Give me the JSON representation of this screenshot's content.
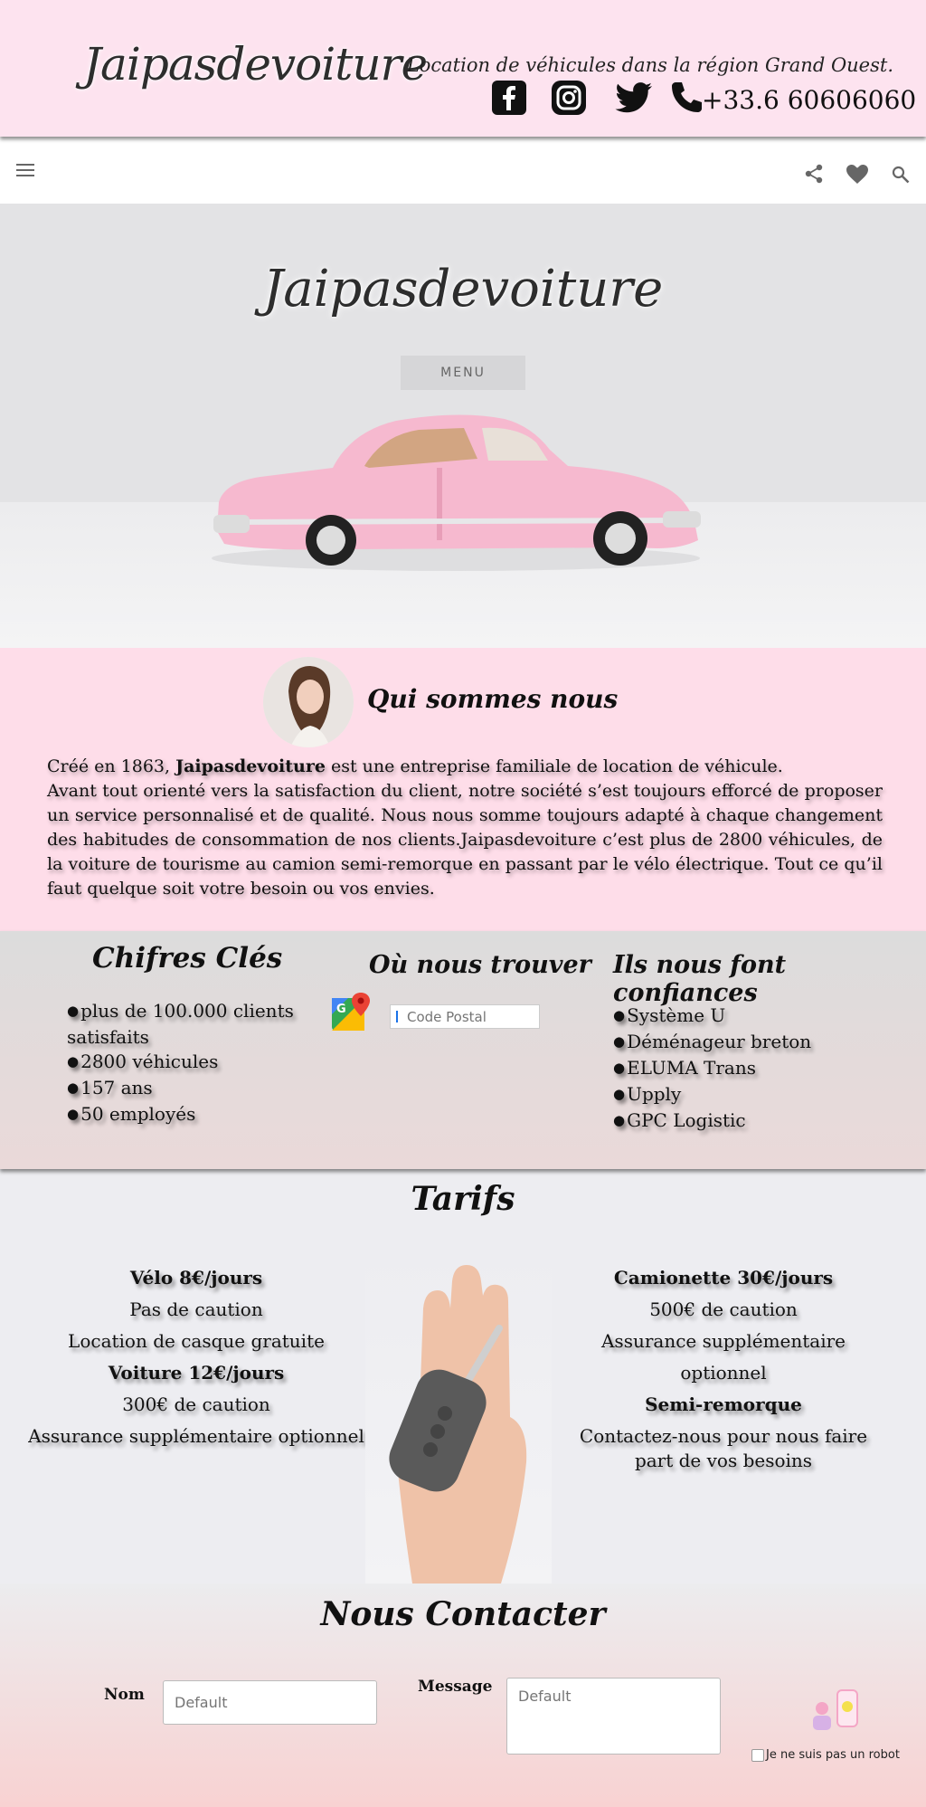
{
  "header": {
    "logo": "Jaipasdevoiture",
    "tagline": "Location de véhicules dans la région Grand Ouest.",
    "phone": "+33.6 60606060",
    "social_icons": [
      "facebook-icon",
      "instagram-icon",
      "twitter-icon",
      "phone-icon"
    ]
  },
  "toolbar": {
    "icons": [
      "menu-icon",
      "share-icon",
      "heart-icon",
      "search-icon"
    ]
  },
  "hero": {
    "title": "Jaipasdevoiture",
    "menu_button": "MENU"
  },
  "about": {
    "title": "Qui sommes nous",
    "intro_prefix": "Créé en 1863, ",
    "intro_brand": "Jaipasdevoiture",
    "intro_suffix": " est une entreprise familiale de location de véhicule.",
    "body": "Avant tout orienté vers la satisfaction du client, notre société s’est toujours efforcé de proposer un service personnalisé et de qualité. Nous nous somme toujours adapté à chaque changement des habitudes de consommation de nos clients.Jaipasdevoiture c’est plus de 2800 véhicules, de la voiture de tourisme au camion semi-remorque en passant par le vélo électrique. Tout ce qu’il faut quelque soit votre besoin ou vos envies."
  },
  "figures": {
    "title": "Chifres Clés",
    "items": [
      "plus de 100.000 clients satisfaits",
      "2800 véhicules",
      "157 ans",
      "50 employés"
    ]
  },
  "locate": {
    "title": "Où nous trouver",
    "postal_placeholder": "Code Postal"
  },
  "trust": {
    "title": "Ils nous font confiances",
    "items": [
      "Système U",
      "Déménageur breton",
      "ELUMA Trans",
      "Upply",
      "GPC Logistic"
    ]
  },
  "tarifs": {
    "title": "Tarifs",
    "left": [
      {
        "text": "Vélo 8€/jours",
        "strong": true
      },
      {
        "text": "Pas de caution",
        "strong": false
      },
      {
        "text": "Location de casque gratuite",
        "strong": false
      },
      {
        "text": "Voiture 12€/jours",
        "strong": true
      },
      {
        "text": "300€ de caution",
        "strong": false
      },
      {
        "text": "Assurance supplémentaire optionnel",
        "strong": false
      }
    ],
    "right": [
      {
        "text": "Camionette 30€/jours",
        "strong": true
      },
      {
        "text": "500€ de caution",
        "strong": false
      },
      {
        "text": "Assurance supplémentaire optionnel",
        "strong": false
      },
      {
        "text": "Semi-remorque",
        "strong": true
      },
      {
        "text": "Contactez-nous pour nous faire part de vos besoins",
        "strong": false
      }
    ]
  },
  "contact": {
    "title": "Nous Contacter",
    "name_label": "Nom",
    "name_placeholder": "Default",
    "message_label": "Message",
    "message_placeholder": "Default",
    "robot_label": "Je ne suis pas un robot"
  },
  "colors": {
    "header_bg": "#fde3ef",
    "about_bg": "#fedde9",
    "hero_bg": "#e3e3e5",
    "car_pink": "#f6b9cf"
  }
}
